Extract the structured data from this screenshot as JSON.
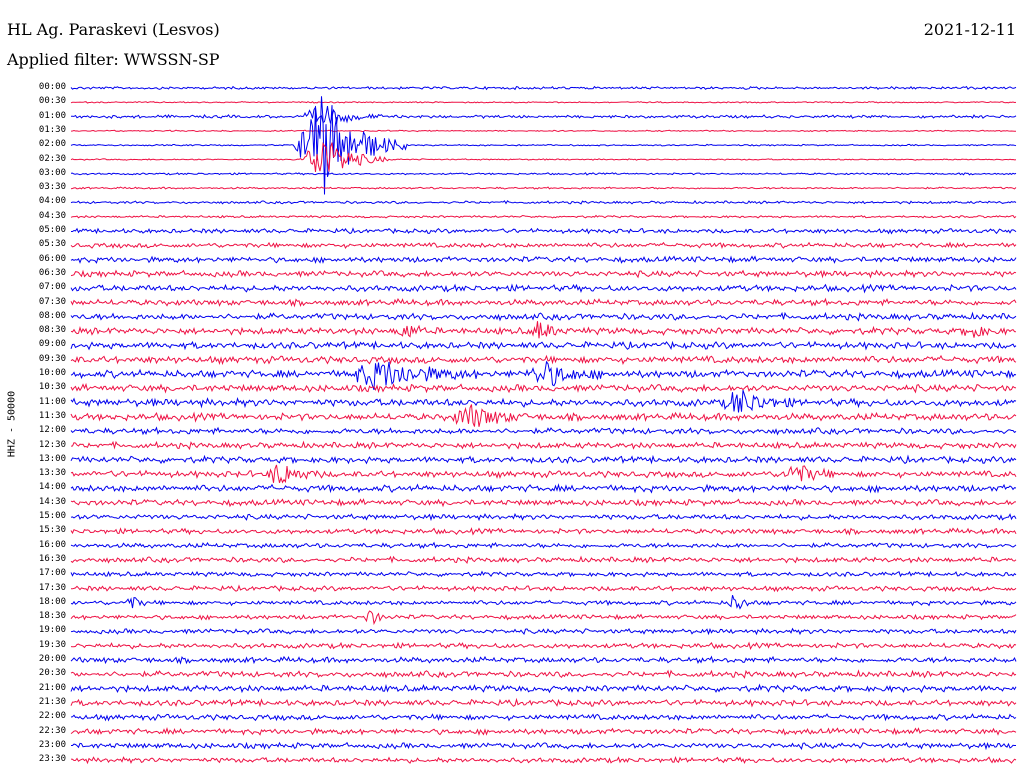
{
  "header": {
    "station": "HL Ag. Paraskevi (Lesvos)",
    "date": "2021-12-11",
    "filter_label": "Applied filter: WWSSN-SP"
  },
  "channel_label": "HHZ - 50000",
  "chart_data": {
    "type": "line",
    "title": "HL Ag. Paraskevi (Lesvos)",
    "subtitle": "Applied filter: WWSSN-SP",
    "ylabel": "HHZ - 50000",
    "xlabel": "",
    "grid": false,
    "trace_colors": [
      "#0000ee",
      "#ee1144"
    ],
    "hour_labels": [
      "00:00",
      "00:30",
      "01:00",
      "01:30",
      "02:00",
      "02:30",
      "03:00",
      "03:30",
      "04:00",
      "04:30",
      "05:00",
      "05:30",
      "06:00",
      "06:30",
      "07:00",
      "07:30",
      "08:00",
      "08:30",
      "09:00",
      "09:30",
      "10:00",
      "10:30",
      "11:00",
      "11:30",
      "12:00",
      "12:30",
      "13:00",
      "13:30",
      "14:00",
      "14:30",
      "15:00",
      "15:30",
      "16:00",
      "16:30",
      "17:00",
      "17:30",
      "18:00",
      "18:30",
      "19:00",
      "19:30",
      "20:00",
      "20:30",
      "21:00",
      "21:30",
      "22:00",
      "22:30",
      "23:00",
      "23:30"
    ],
    "noise_level": [
      0.7,
      0.35,
      0.8,
      0.35,
      0.4,
      0.35,
      0.5,
      0.5,
      0.7,
      0.6,
      1.2,
      1.3,
      1.5,
      1.6,
      1.7,
      1.6,
      1.7,
      1.8,
      1.8,
      1.9,
      2.0,
      1.9,
      2.0,
      1.9,
      1.6,
      1.6,
      1.7,
      1.7,
      1.8,
      1.6,
      1.4,
      1.4,
      1.3,
      1.4,
      1.2,
      1.3,
      1.2,
      1.2,
      1.3,
      1.4,
      1.5,
      1.6,
      1.7,
      1.6,
      1.5,
      1.5,
      1.5,
      1.4
    ]
  }
}
